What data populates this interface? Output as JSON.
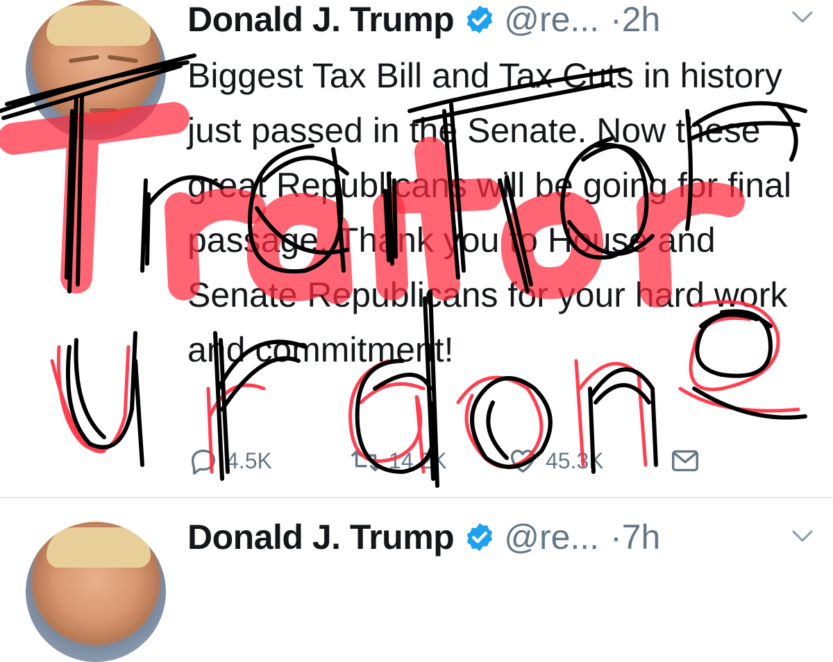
{
  "tweets": [
    {
      "name": "Donald J. Trump",
      "handle": "@re...",
      "time": "·2h",
      "text": "Biggest Tax Bill and Tax Cuts in history just passed in the Senate. Now these great Republicans will be going for final passage. Thank you to House and Senate Republicans for your hard work and commitment!",
      "reply_count": "4.5K",
      "retweet_count": "14.2K",
      "like_count": "45.3K"
    },
    {
      "name": "Donald J. Trump",
      "handle": "@re...",
      "time": "·7h"
    }
  ],
  "graffiti": {
    "red_word": "Traitor",
    "black_word": "Traitor",
    "bottom_word": "u r done"
  },
  "colors": {
    "verified": "#1da1f2",
    "secondary_text": "#657786",
    "graffiti_red": "#ff2a3d",
    "graffiti_black": "#000000"
  },
  "icons": [
    "verified-badge-icon",
    "chevron-down-icon",
    "reply-icon",
    "retweet-icon",
    "like-icon",
    "direct-message-icon"
  ]
}
